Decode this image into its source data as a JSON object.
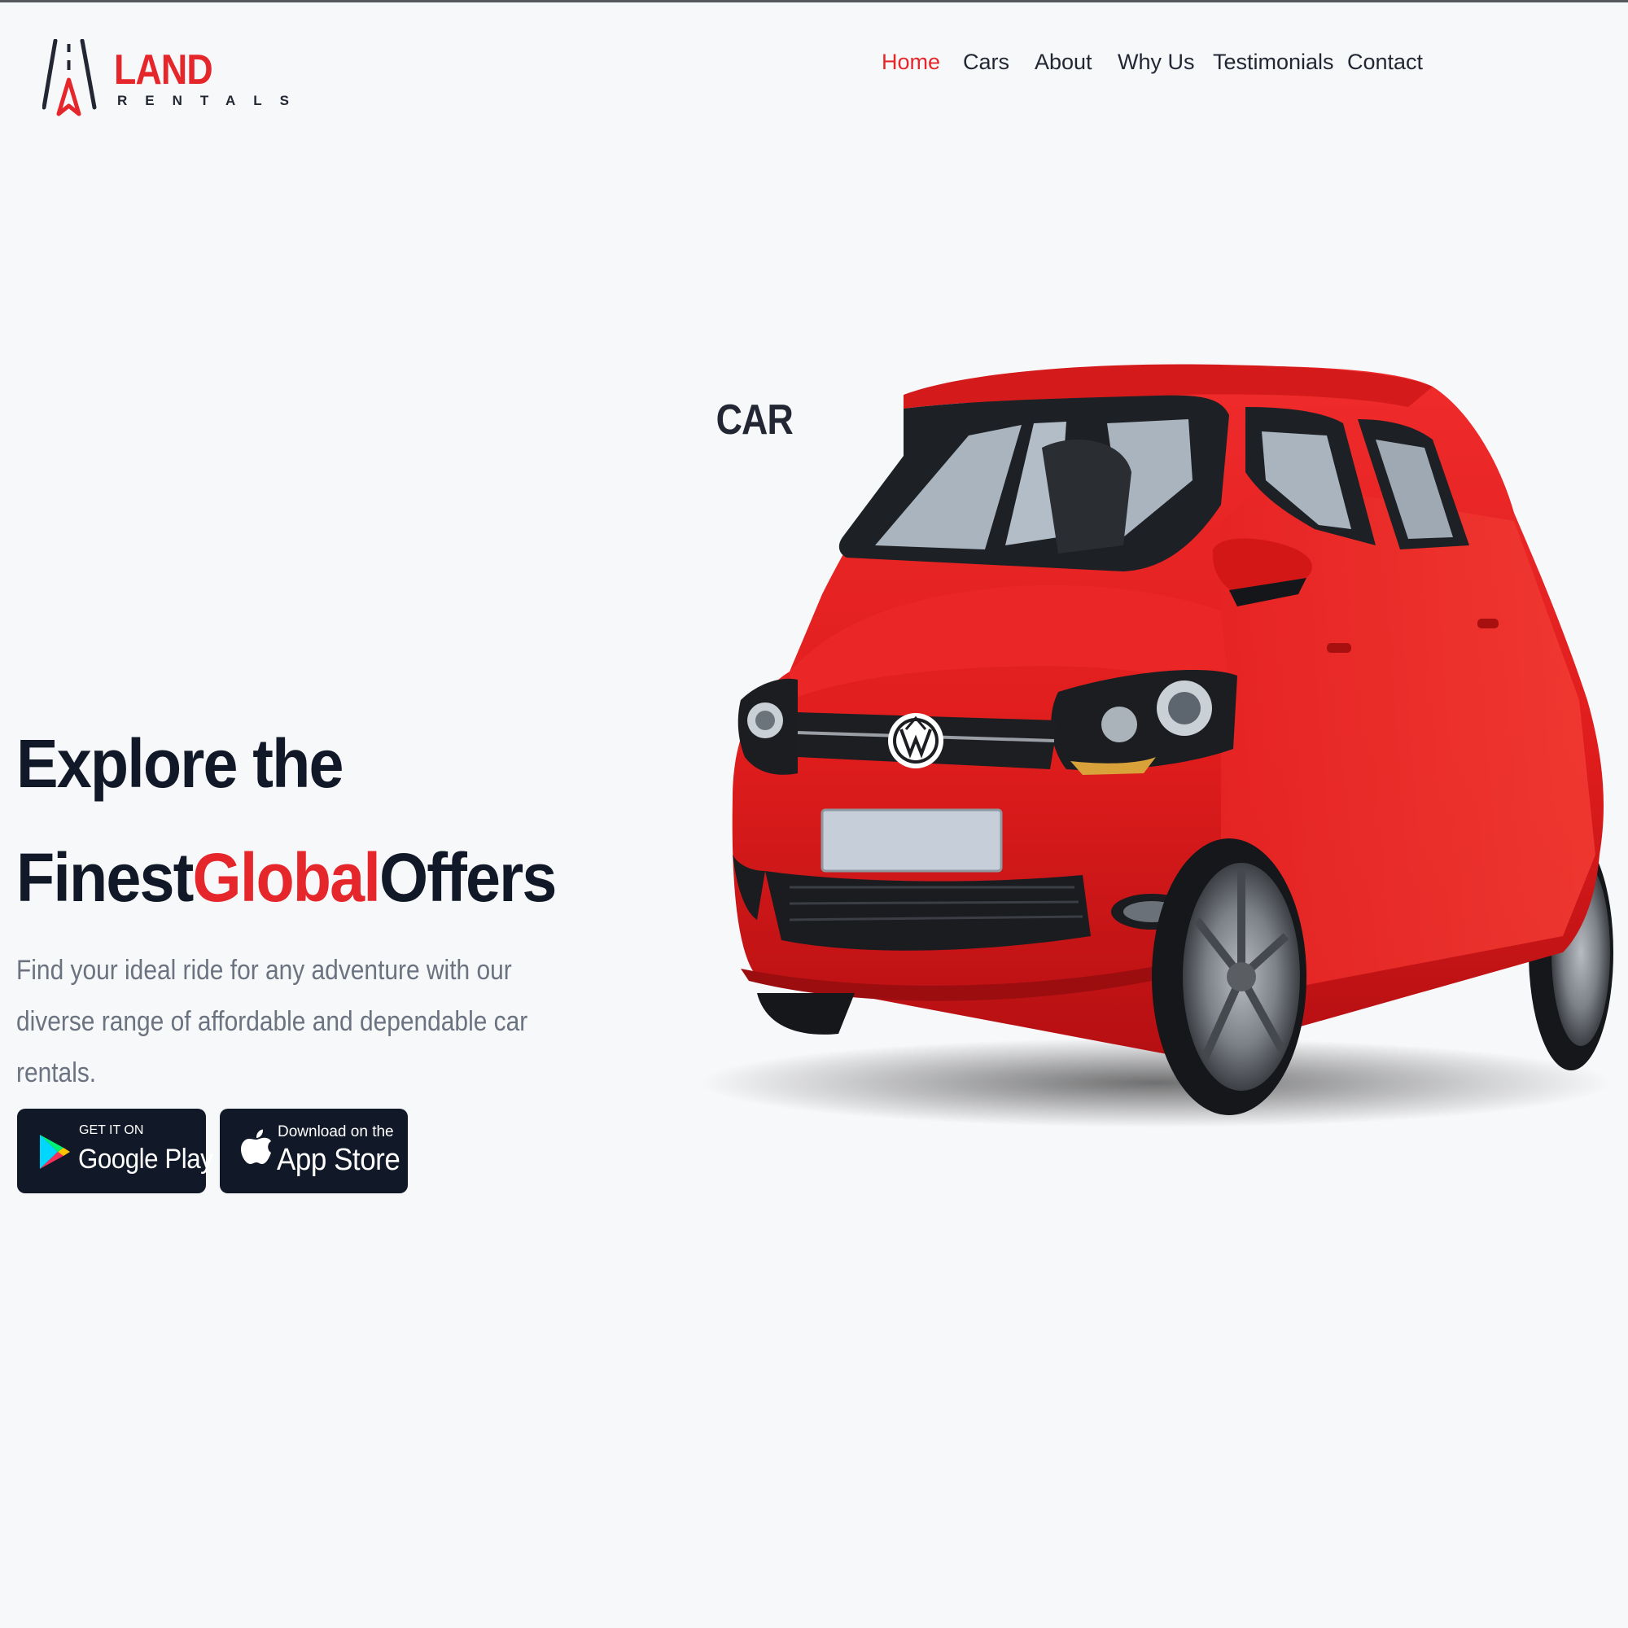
{
  "brand": {
    "name_part1": "CAR",
    "name_part2": "LAND",
    "tagline": "RENTALS",
    "logo_icon": "road-icon",
    "accent_color": "#e5262b",
    "dark_color": "#111827"
  },
  "nav": {
    "items": [
      {
        "label": "Home",
        "active": true
      },
      {
        "label": "Cars",
        "active": false
      },
      {
        "label": "About",
        "active": false
      },
      {
        "label": "Why Us",
        "active": false
      },
      {
        "label": "Testimonials",
        "active": false
      },
      {
        "label": "Contact",
        "active": false
      }
    ]
  },
  "hero": {
    "title_line1": "Explore the",
    "title_word1": "Finest",
    "title_accent": "Global",
    "title_word3": "Offers",
    "description": "Find your ideal ride for any adventure with our diverse range of affordable and dependable car rentals.",
    "car_image": "red-hatchback-car"
  },
  "store_buttons": {
    "google_play": {
      "small": "GET IT ON",
      "big": "Google Play",
      "icon": "google-play-icon"
    },
    "app_store": {
      "small": "Download on the",
      "big": "App Store",
      "icon": "apple-icon"
    }
  }
}
